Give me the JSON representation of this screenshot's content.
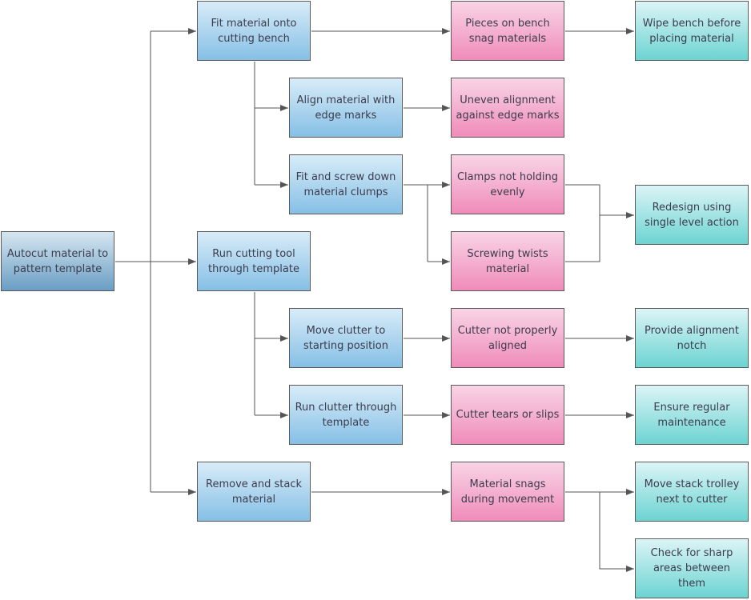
{
  "nodes": {
    "root": "Autocut material to pattern template",
    "fit_material": "Fit material onto cutting bench",
    "run_cutting": "Run cutting tool through template",
    "remove_stack": "Remove and stack material",
    "align_material": "Align material with edge marks",
    "fit_screw": "Fit and screw down material clumps",
    "move_clutter": "Move clutter to starting position",
    "run_clutter": "Run clutter through template",
    "pieces_snag": "Pieces on bench snag materials",
    "uneven_alignment": "Uneven alignment against edge marks",
    "clamps_not_holding": "Clamps not holding evenly",
    "screwing_twists": "Screwing twists material",
    "cutter_not_aligned": "Cutter not properly aligned",
    "cutter_tears": "Cutter tears or slips",
    "material_snags": "Material snags during movement",
    "wipe_bench": "Wipe bench before placing material",
    "redesign": "Redesign using single level action",
    "alignment_notch": "Provide alignment notch",
    "maintenance": "Ensure regular maintenance",
    "move_trolley": "Move stack trolley next to cutter",
    "sharp_areas": "Check for sharp areas between them"
  },
  "colors": {
    "root": "#6a9ec4",
    "step": "#86bfe6",
    "failure": "#f08cba",
    "solution": "#6cd4d2",
    "connector": "#555555"
  }
}
